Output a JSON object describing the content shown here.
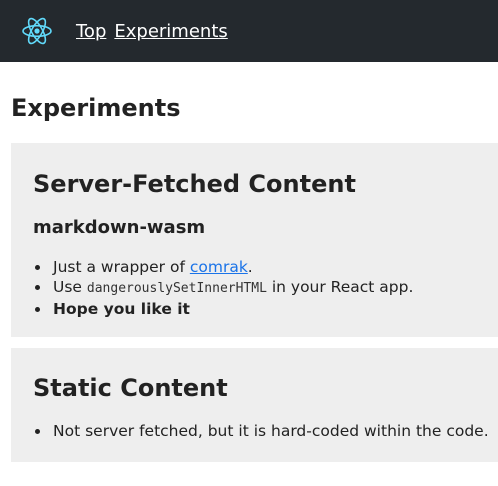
{
  "nav": {
    "logo_icon": "react-atom-icon",
    "links": [
      "Top",
      "Experiments"
    ]
  },
  "page": {
    "title": "Experiments"
  },
  "server_section": {
    "title": "Server-Fetched Content",
    "subtitle": "markdown-wasm",
    "item1_text": "Just a wrapper of ",
    "item1_link": "comrak",
    "item1_suffix": ".",
    "item2_prefix": "Use ",
    "item2_code": "dangerouslySetInnerHTML",
    "item2_suffix": " in your React app.",
    "item3_text": "Hope you like it"
  },
  "static_section": {
    "title": "Static Content",
    "item1_text": "Not server fetched, but it is hard-coded within the code."
  },
  "colors": {
    "nav_bg": "#24292e",
    "react_blue": "#61dafb",
    "card_bg": "#eeeeee",
    "link": "#1a73e8"
  }
}
